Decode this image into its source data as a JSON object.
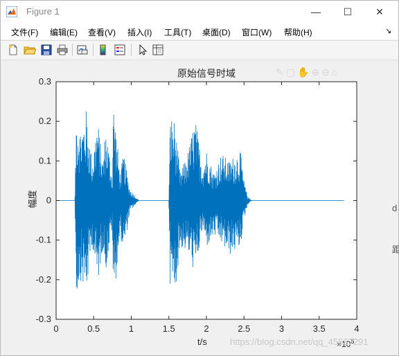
{
  "window": {
    "title": "Figure 1",
    "controls": {
      "minimize": "—",
      "maximize": "☐",
      "close": "✕"
    }
  },
  "menubar": {
    "items": [
      "文件(F)",
      "编辑(E)",
      "查看(V)",
      "插入(I)",
      "工具(T)",
      "桌面(D)",
      "窗口(W)",
      "帮助(H)"
    ],
    "dock_glyph": "↘"
  },
  "toolbar": {
    "icons": [
      "new-figure-icon",
      "open-file-icon",
      "save-icon",
      "print-icon",
      "link-plot-icon",
      "insert-colorbar-icon",
      "insert-legend-icon",
      "edit-plot-pointer-icon",
      "property-inspector-icon"
    ]
  },
  "axes_toolbar_glyphs": "✎▢✋⊕⊖⌂",
  "watermark": "https://blog.csdn.net/qq_45537291",
  "edge_fragments": [
    "d",
    "距"
  ],
  "chart_data": {
    "type": "line",
    "title": "原始信号时域",
    "xlabel": "t/s",
    "ylabel": "幅度",
    "x_exponent": "×10",
    "x_exponent_power": "5",
    "xlim": [
      0,
      4
    ],
    "ylim": [
      -0.3,
      0.3
    ],
    "xticks": [
      "0",
      "0.5",
      "1",
      "1.5",
      "2",
      "2.5",
      "3",
      "3.5",
      "4"
    ],
    "yticks": [
      "0.3",
      "0.2",
      "0.1",
      "0",
      "-0.1",
      "-0.2",
      "-0.3"
    ],
    "xtick_values": [
      0,
      0.5,
      1,
      1.5,
      2,
      2.5,
      3,
      3.5,
      4
    ],
    "ytick_values": [
      0.3,
      0.2,
      0.1,
      0,
      -0.1,
      -0.2,
      -0.3
    ],
    "series": [
      {
        "color": "#0072bd",
        "signal_extent": [
          0,
          3.83
        ],
        "envelope": [
          {
            "x": 0.25,
            "pos": 0.0,
            "neg": 0.0
          },
          {
            "x": 0.27,
            "pos": 0.23,
            "neg": -0.24
          },
          {
            "x": 0.33,
            "pos": 0.18,
            "neg": -0.2
          },
          {
            "x": 0.4,
            "pos": 0.23,
            "neg": -0.24
          },
          {
            "x": 0.48,
            "pos": 0.1,
            "neg": -0.11
          },
          {
            "x": 0.55,
            "pos": 0.21,
            "neg": -0.22
          },
          {
            "x": 0.62,
            "pos": 0.1,
            "neg": -0.12
          },
          {
            "x": 0.66,
            "pos": 0.19,
            "neg": -0.18
          },
          {
            "x": 0.75,
            "pos": 0.06,
            "neg": -0.07
          },
          {
            "x": 0.76,
            "pos": 0.26,
            "neg": -0.27
          },
          {
            "x": 0.85,
            "pos": 0.07,
            "neg": -0.09
          },
          {
            "x": 0.9,
            "pos": 0.12,
            "neg": -0.13
          },
          {
            "x": 0.98,
            "pos": 0.03,
            "neg": -0.03
          },
          {
            "x": 1.1,
            "pos": 0.0,
            "neg": 0.0
          },
          {
            "x": 1.5,
            "pos": 0.0,
            "neg": 0.0
          },
          {
            "x": 1.52,
            "pos": 0.22,
            "neg": -0.23
          },
          {
            "x": 1.58,
            "pos": 0.2,
            "neg": -0.24
          },
          {
            "x": 1.65,
            "pos": 0.07,
            "neg": -0.12
          },
          {
            "x": 1.75,
            "pos": 0.12,
            "neg": -0.13
          },
          {
            "x": 1.85,
            "pos": 0.21,
            "neg": -0.19
          },
          {
            "x": 1.95,
            "pos": 0.09,
            "neg": -0.07
          },
          {
            "x": 2.0,
            "pos": 0.13,
            "neg": -0.12
          },
          {
            "x": 2.1,
            "pos": 0.07,
            "neg": -0.09
          },
          {
            "x": 2.2,
            "pos": 0.12,
            "neg": -0.11
          },
          {
            "x": 2.3,
            "pos": 0.1,
            "neg": -0.14
          },
          {
            "x": 2.45,
            "pos": 0.13,
            "neg": -0.12
          },
          {
            "x": 2.5,
            "pos": 0.05,
            "neg": -0.05
          },
          {
            "x": 2.55,
            "pos": 0.01,
            "neg": -0.01
          },
          {
            "x": 2.6,
            "pos": 0.0,
            "neg": 0.0
          },
          {
            "x": 3.83,
            "pos": 0.0,
            "neg": 0.0
          }
        ]
      }
    ],
    "grid": false
  }
}
